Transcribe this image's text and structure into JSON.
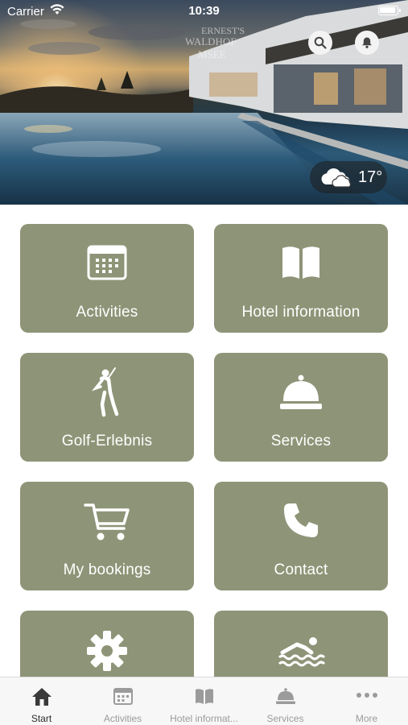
{
  "status_bar": {
    "carrier": "Carrier",
    "time": "10:39"
  },
  "weather": {
    "temperature": "17°",
    "icon": "cloud-icon"
  },
  "tiles": [
    {
      "label": "Activities",
      "icon": "calendar-icon"
    },
    {
      "label": "Hotel information",
      "icon": "book-icon"
    },
    {
      "label": "Golf-Erlebnis",
      "icon": "golfer-icon"
    },
    {
      "label": "Services",
      "icon": "service-bell-icon"
    },
    {
      "label": "My bookings",
      "icon": "cart-icon"
    },
    {
      "label": "Contact",
      "icon": "phone-icon"
    },
    {
      "label": "",
      "icon": "gear-icon"
    },
    {
      "label": "",
      "icon": "swimmer-icon"
    }
  ],
  "tabbar": {
    "items": [
      {
        "label": "Start",
        "icon": "home-icon",
        "active": true
      },
      {
        "label": "Activities",
        "icon": "calendar-icon"
      },
      {
        "label": "Hotel informat...",
        "icon": "book-icon"
      },
      {
        "label": "Services",
        "icon": "service-bell-icon"
      },
      {
        "label": "More",
        "icon": "more-icon"
      }
    ]
  },
  "colors": {
    "tile": "#8e9477",
    "tab_active": "#2b2b2b",
    "tab_inactive": "#9b9b9b"
  }
}
